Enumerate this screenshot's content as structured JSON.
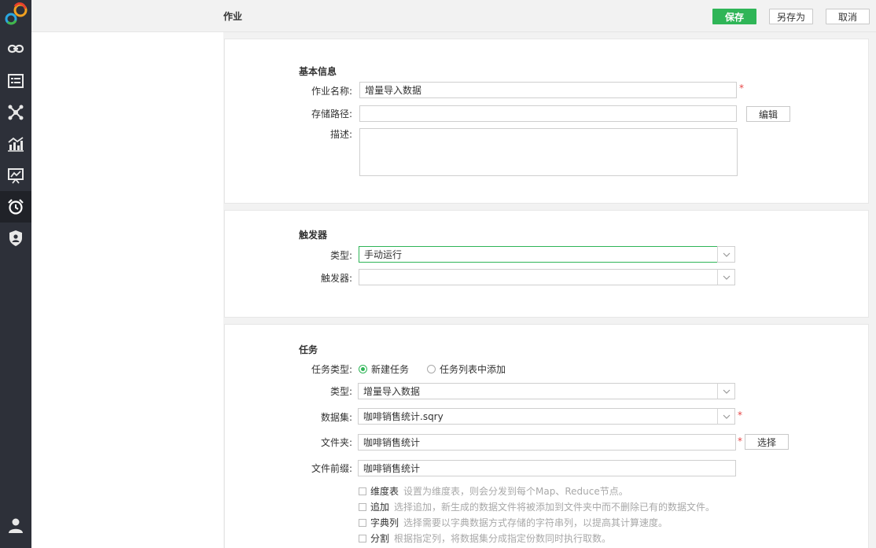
{
  "header": {
    "title": "作业",
    "save_label": "保存",
    "save_as_label": "另存为",
    "cancel_label": "取消"
  },
  "colors": {
    "accent": "#2fb557",
    "rail": "#2d3039",
    "required": "#e64545"
  },
  "rail_icons": [
    "link-icon",
    "list-icon",
    "network-icon",
    "bar-chart-icon",
    "presentation-icon",
    "alarm-clock-icon",
    "shield-user-icon",
    "user-icon"
  ],
  "basic": {
    "title": "基本信息",
    "name_label": "作业名称:",
    "name_value": "增量导入数据",
    "path_label": "存储路径:",
    "path_value": "",
    "edit_label": "编辑",
    "desc_label": "描述:"
  },
  "trigger": {
    "title": "触发器",
    "type_label": "类型:",
    "type_value": "手动运行",
    "trigger_label": "触发器:",
    "trigger_value": ""
  },
  "task": {
    "title": "任务",
    "task_type_label": "任务类型:",
    "option_new": "新建任务",
    "option_list": "任务列表中添加",
    "type_label": "类型:",
    "type_value": "增量导入数据",
    "dataset_label": "数据集:",
    "dataset_value": "咖啡销售统计.sqry",
    "folder_label": "文件夹:",
    "folder_value": "咖啡销售统计",
    "select_label": "选择",
    "prefix_label": "文件前缀:",
    "prefix_value": "咖啡销售统计",
    "options": [
      {
        "name": "维度表",
        "desc": "设置为维度表，则会分发到每个Map、Reduce节点。"
      },
      {
        "name": "追加",
        "desc": "选择追加，新生成的数据文件将被添加到文件夹中而不删除已有的数据文件。"
      },
      {
        "name": "字典列",
        "desc": "选择需要以字典数据方式存储的字符串列，以提高其计算速度。"
      },
      {
        "name": "分割",
        "desc": "根据指定列，将数据集分成指定份数同时执行取数。"
      }
    ]
  }
}
